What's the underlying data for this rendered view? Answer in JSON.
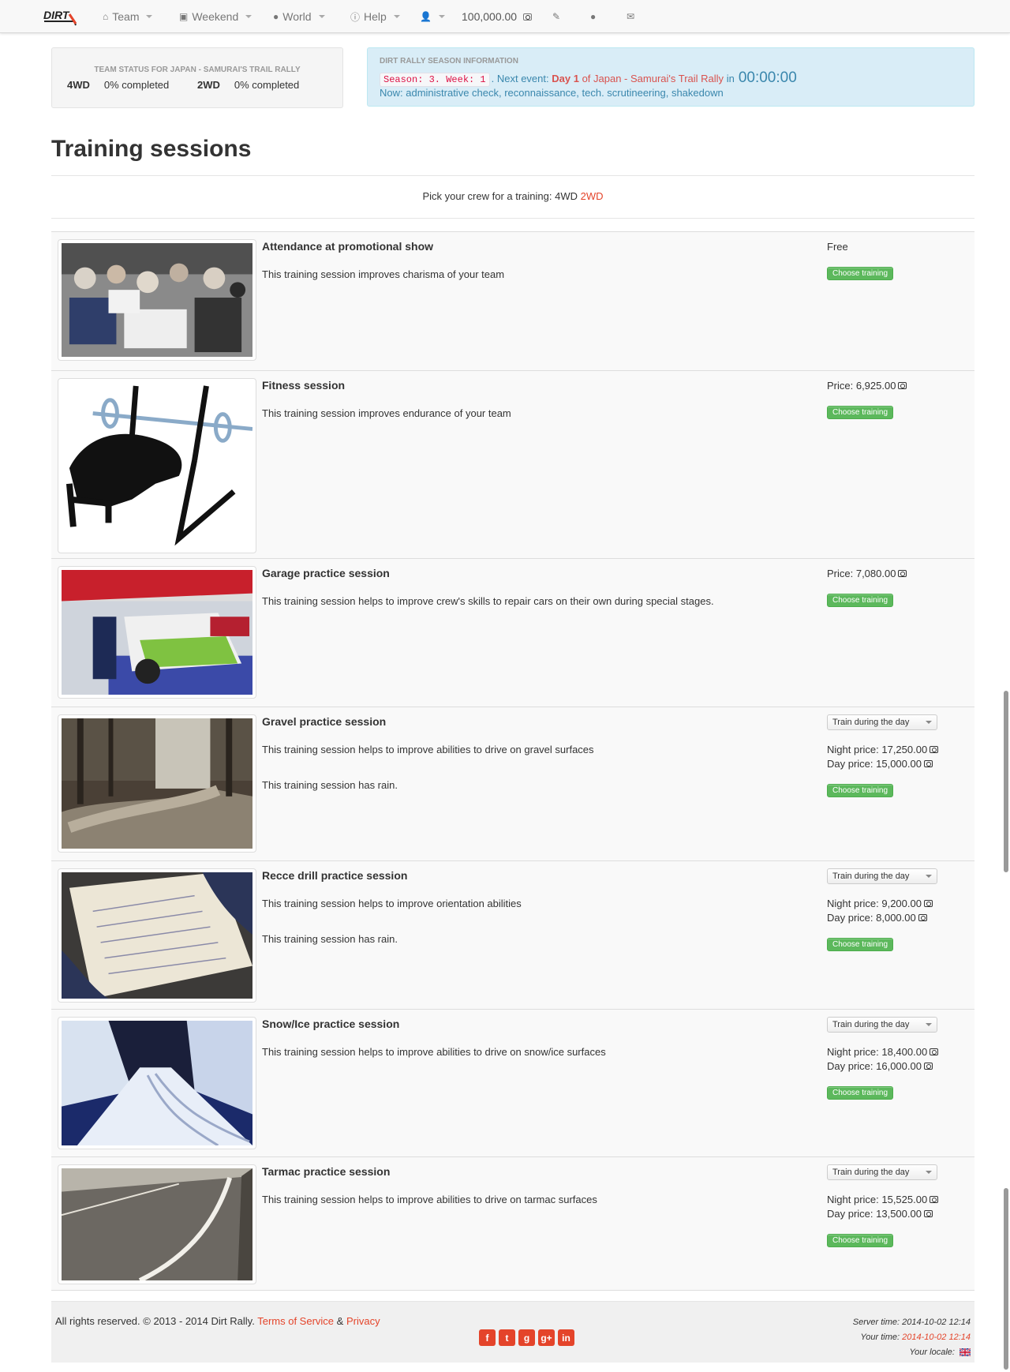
{
  "nav": {
    "logo_text": "DIRT",
    "team": "Team",
    "weekend": "Weekend",
    "world": "World",
    "help": "Help",
    "money": "100,000.00"
  },
  "team_status": {
    "title": "TEAM STATUS FOR JAPAN - SAMURAI'S TRAIL RALLY",
    "awd_label": "4WD",
    "awd_value": "0% completed",
    "rwd_label": "2WD",
    "rwd_value": "0% completed"
  },
  "season_info": {
    "title": "DIRT RALLY SEASON INFORMATION",
    "season_code": "Season: 3. Week: 1",
    "next_event_prefix": ". Next event:",
    "day": "Day 1",
    "event": "of Japan - Samurai's Trail Rally",
    "in": "in",
    "countdown": "00:00:00",
    "now": "Now: administrative check, reconnaissance, tech. scrutineering, shakedown"
  },
  "page_title": "Training sessions",
  "pick": {
    "prefix": "Pick your crew for a training:",
    "awd": "4WD",
    "rwd": "2WD"
  },
  "sessions": [
    {
      "title": "Attendance at promotional show",
      "desc": "This training session improves charisma of your team",
      "price": "Free",
      "button": "Choose training"
    },
    {
      "title": "Fitness session",
      "desc": "This training session improves endurance of your team",
      "price": "Price: 6,925.00",
      "button": "Choose training"
    },
    {
      "title": "Garage practice session",
      "desc": "This training session helps to improve crew's skills to repair cars on their own during special stages.",
      "price": "Price: 7,080.00",
      "button": "Choose training"
    },
    {
      "title": "Gravel practice session",
      "desc": "This training session helps to improve abilities to drive on gravel surfaces",
      "rain": "This training session has rain.",
      "select": "Train during the day",
      "night": "Night price: 17,250.00",
      "day": "Day price: 15,000.00",
      "button": "Choose training"
    },
    {
      "title": "Recce drill practice session",
      "desc": "This training session helps to improve orientation abilities",
      "rain": "This training session has rain.",
      "select": "Train during the day",
      "night": "Night price: 9,200.00",
      "day": "Day price: 8,000.00",
      "button": "Choose training"
    },
    {
      "title": "Snow/Ice practice session",
      "desc": "This training session helps to improve abilities to drive on snow/ice surfaces",
      "select": "Train during the day",
      "night": "Night price: 18,400.00",
      "day": "Day price: 16,000.00",
      "button": "Choose training"
    },
    {
      "title": "Tarmac practice session",
      "desc": "This training session helps to improve abilities to drive on tarmac surfaces",
      "select": "Train during the day",
      "night": "Night price: 15,525.00",
      "day": "Day price: 13,500.00",
      "button": "Choose training"
    }
  ],
  "footer": {
    "copyright": "All rights reserved. © 2013 - 2014 Dirt Rally.",
    "tos": "Terms of Service",
    "amp": "&",
    "privacy": "Privacy",
    "server_time": "Server time: 2014-10-02 12:14",
    "your_time_label": "Your time:",
    "your_time": "2014-10-02 12:14",
    "locale_label": "Your locale:",
    "socials": [
      "f",
      "t",
      "g",
      "g+",
      "in"
    ]
  }
}
